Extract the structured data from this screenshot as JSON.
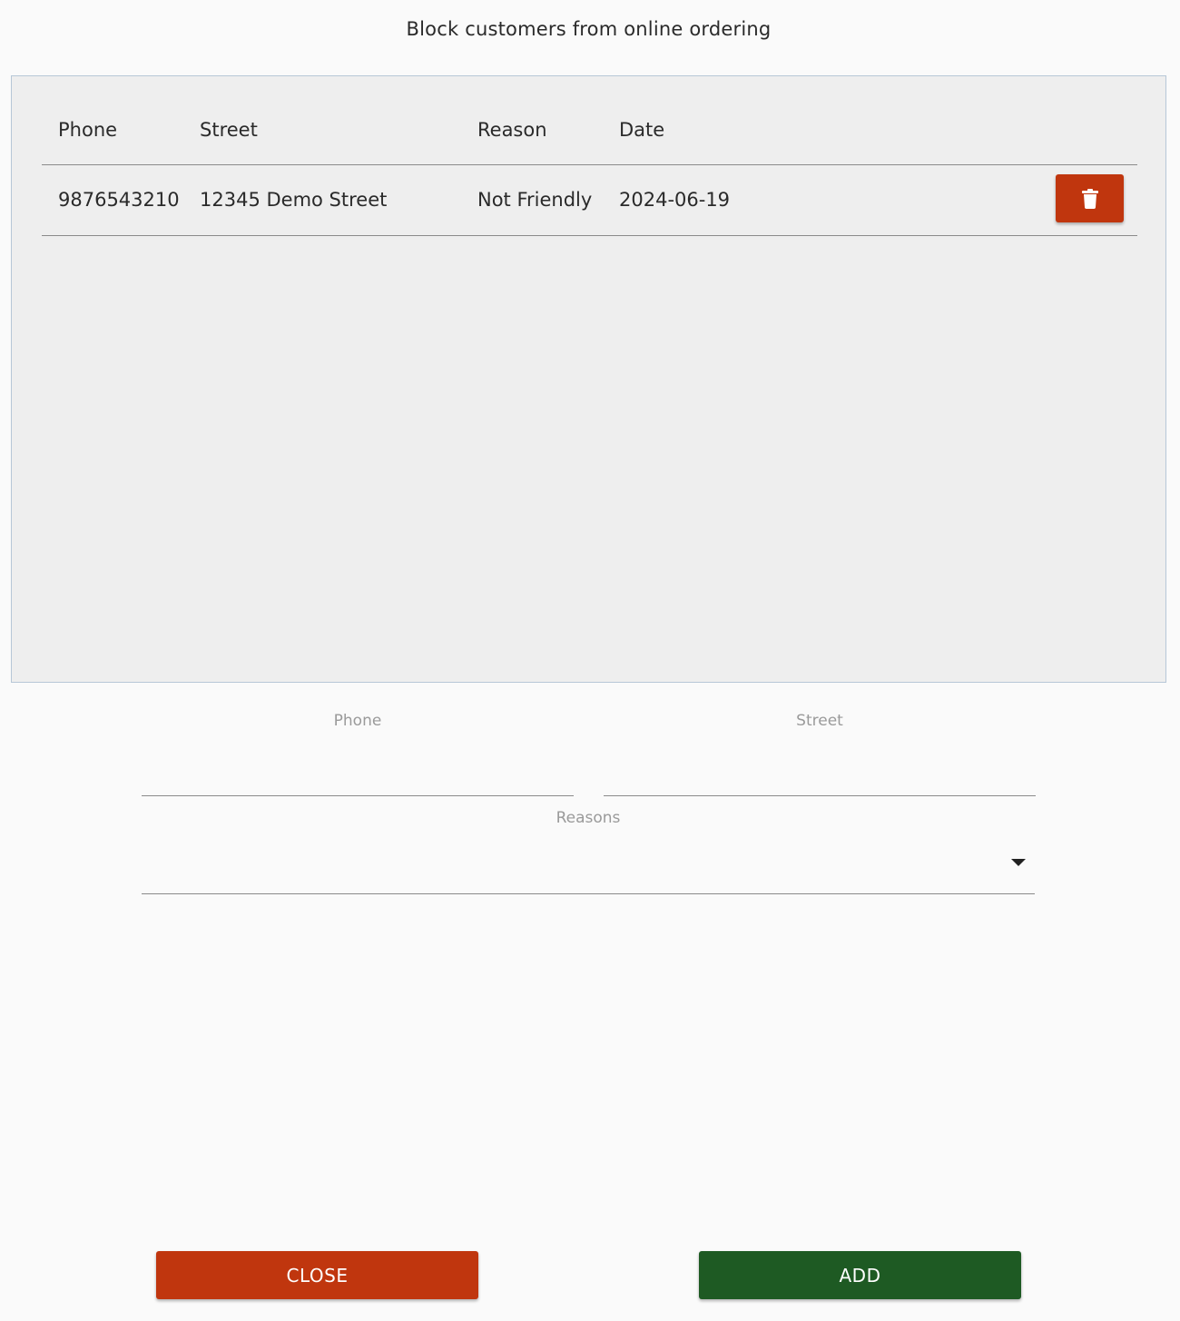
{
  "header": {
    "subtitle": "Block customers from online ordering"
  },
  "table": {
    "columns": {
      "phone": "Phone",
      "street": "Street",
      "reason": "Reason",
      "date": "Date"
    },
    "rows": [
      {
        "phone": "9876543210",
        "street": "12345 Demo Street",
        "reason": "Not Friendly",
        "date": "2024-06-19",
        "action_icon": "trash-icon"
      }
    ]
  },
  "form": {
    "phone_label": "Phone",
    "phone_value": "",
    "street_label": "Street",
    "street_value": "",
    "reasons_label": "Reasons",
    "reasons_value": ""
  },
  "actions": {
    "close_label": "Close",
    "add_label": "Add"
  },
  "colors": {
    "danger": "#c0360e",
    "primary": "#1e5a23",
    "panel_background": "#eeeeee"
  }
}
